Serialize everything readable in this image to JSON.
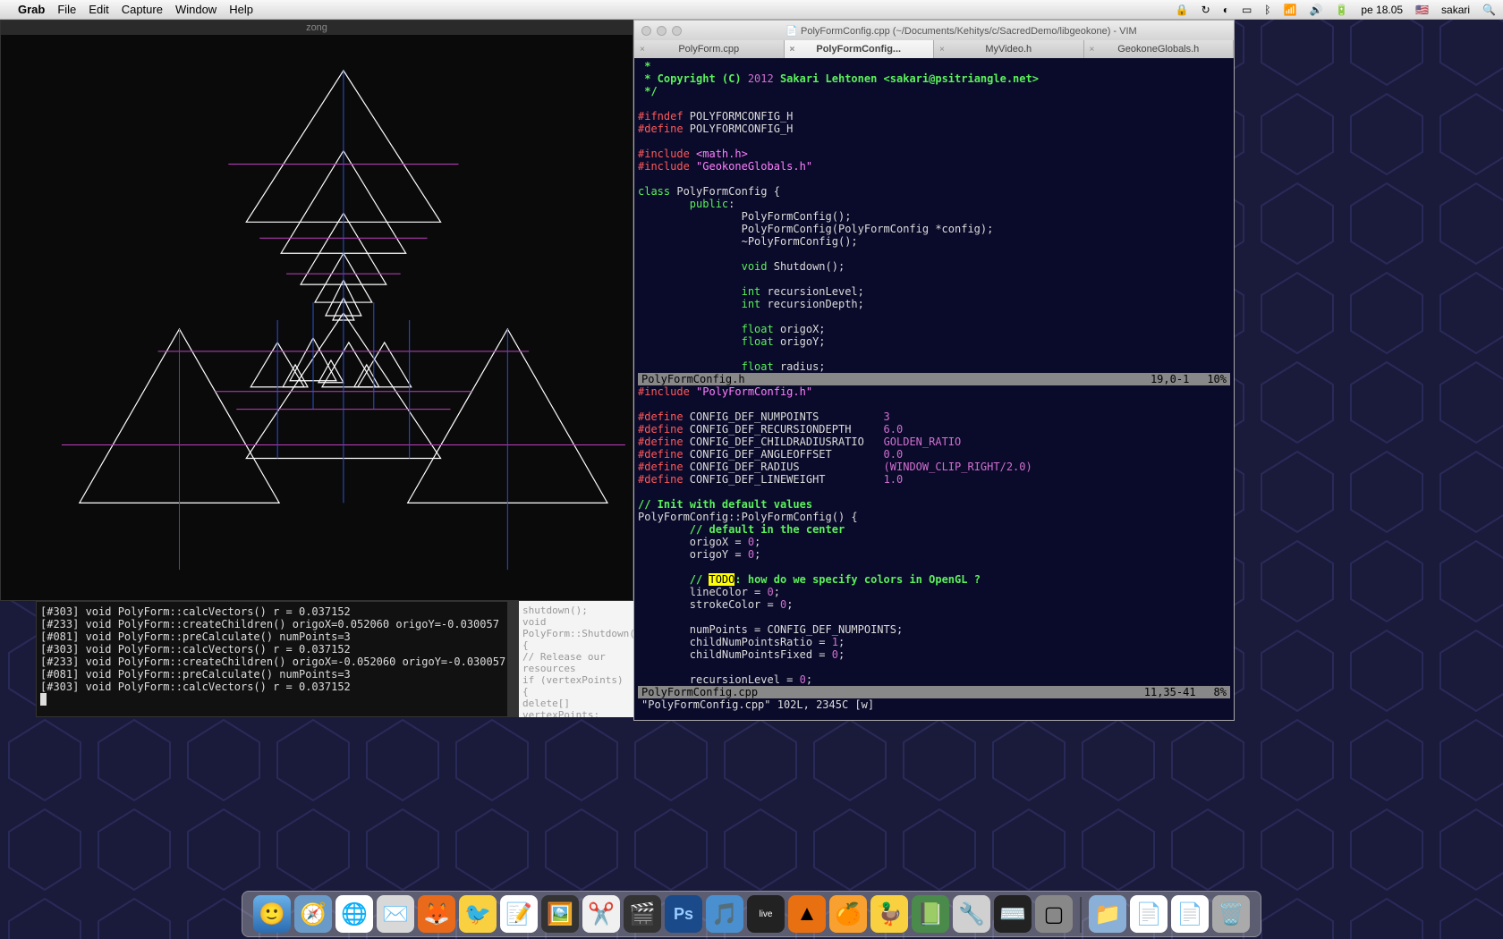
{
  "menubar": {
    "app": "Grab",
    "items": [
      "File",
      "Edit",
      "Capture",
      "Window",
      "Help"
    ],
    "right": {
      "time": "pe 18.05",
      "user": "sakari"
    }
  },
  "left_window": {
    "title": "zong"
  },
  "log": {
    "lines": [
      "[#303] void PolyForm::calcVectors() r = 0.037152",
      "[#233] void PolyForm::createChildren() origoX=0.052060 origoY=-0.030057",
      "[#081] void PolyForm::preCalculate() numPoints=3",
      "[#303] void PolyForm::calcVectors() r = 0.037152",
      "[#233] void PolyForm::createChildren() origoX=-0.052060 origoY=-0.030057",
      "[#081] void PolyForm::preCalculate() numPoints=3",
      "[#303] void PolyForm::calcVectors() r = 0.037152"
    ]
  },
  "partial": {
    "lines": [
      "shutdown();",
      "",
      "void PolyForm::Shutdown() {",
      "   // Release our resources",
      "   if (vertexPoints) {",
      "       delete[] vertexPoints;",
      "   }",
      "}"
    ]
  },
  "vim": {
    "title": "PolyFormConfig.cpp (~/Documents/Kehitys/c/SacredDemo/libgeokone) - VIM",
    "tabs": [
      {
        "label": "PolyForm.cpp",
        "active": false
      },
      {
        "label": "PolyFormConfig...",
        "active": true
      },
      {
        "label": "MyVideo.h",
        "active": false
      },
      {
        "label": "GeokoneGlobals.h",
        "active": false
      }
    ],
    "split_top": {
      "filename": "PolyFormConfig.h",
      "cursor": "19,0-1",
      "percent": "10%"
    },
    "split_bottom": {
      "filename": "PolyFormConfig.cpp",
      "cursor": "11,35-41",
      "percent": "8%"
    },
    "cmdline": "\"PolyFormConfig.cpp\" 102L, 2345C [w]",
    "code_top": {
      "comment1": " *",
      "comment2": " * Copyright (C) ",
      "year": "2012",
      "author": " Sakari Lehtonen <sakari@psitriangle.net>",
      "comment3": " */",
      "ifndef": "#ifndef",
      "ifndef_v": " POLYFORMCONFIG_H",
      "define": "#define",
      "define_v": " POLYFORMCONFIG_H",
      "include1": "#include ",
      "include1_v": "<math.h>",
      "include2": "#include ",
      "include2_v": "\"GeokoneGlobals.h\"",
      "class_kw": "class",
      "class_name": " PolyFormConfig {",
      "public": "public",
      "ctor1": "PolyFormConfig();",
      "ctor2": "PolyFormConfig(PolyFormConfig *config);",
      "dtor": "~PolyFormConfig();",
      "void_kw": "void",
      "shutdown": " Shutdown();",
      "int_kw": "int",
      "rlevel": " recursionLevel;",
      "rdepth": " recursionDepth;",
      "float_kw": "float",
      "origox": " origoX;",
      "origoy": " origoY;",
      "radius": " radius;"
    },
    "code_bot": {
      "include": "#include ",
      "include_v": "\"PolyFormConfig.h\"",
      "def": "#define",
      "d1": " CONFIG_DEF_NUMPOINTS",
      "d1v": "3",
      "d2": " CONFIG_DEF_RECURSIONDEPTH",
      "d2v": "6.0",
      "d3": " CONFIG_DEF_CHILDRADIUSRATIO",
      "d3v": "GOLDEN_RATIO",
      "d4": " CONFIG_DEF_ANGLEOFFSET",
      "d4v": "0.0",
      "d5": " CONFIG_DEF_RADIUS",
      "d5v_open": "(WINDOW_CLIP_RIGHT/",
      "d5v_num": "2.0",
      "d5v_close": ")",
      "d6": " CONFIG_DEF_LINEWEIGHT",
      "d6v": "1.0",
      "c1": "// Init with default values",
      "ctor": "PolyFormConfig::PolyFormConfig() {",
      "c2": "// default in the center",
      "ox": "origoX = ",
      "oy": "origoY = ",
      "zero": "0",
      "semi": ";",
      "c3a": "// ",
      "todo": "TODO",
      "c3b": ": how do we specify colors in OpenGL ?",
      "lc": "lineColor = ",
      "sc": "strokeColor = ",
      "np": "numPoints = CONFIG_DEF_NUMPOINTS;",
      "cnpr": "childNumPointsRatio = ",
      "one": "1",
      "cnpf": "childNumPointsFixed = ",
      "rl": "recursionLevel = "
    }
  },
  "dock": {
    "items": [
      "finder",
      "safari-compass",
      "chrome",
      "mail",
      "firefox",
      "tweetie",
      "textedit",
      "imageapp",
      "cut",
      "finalcut",
      "photoshop",
      "itunes",
      "ableton",
      "vlc",
      "clementine",
      "duck",
      "macvim",
      "scissors",
      "terminal",
      "app1"
    ],
    "right_items": [
      "folder",
      "doc1",
      "doc2",
      "trash"
    ]
  }
}
